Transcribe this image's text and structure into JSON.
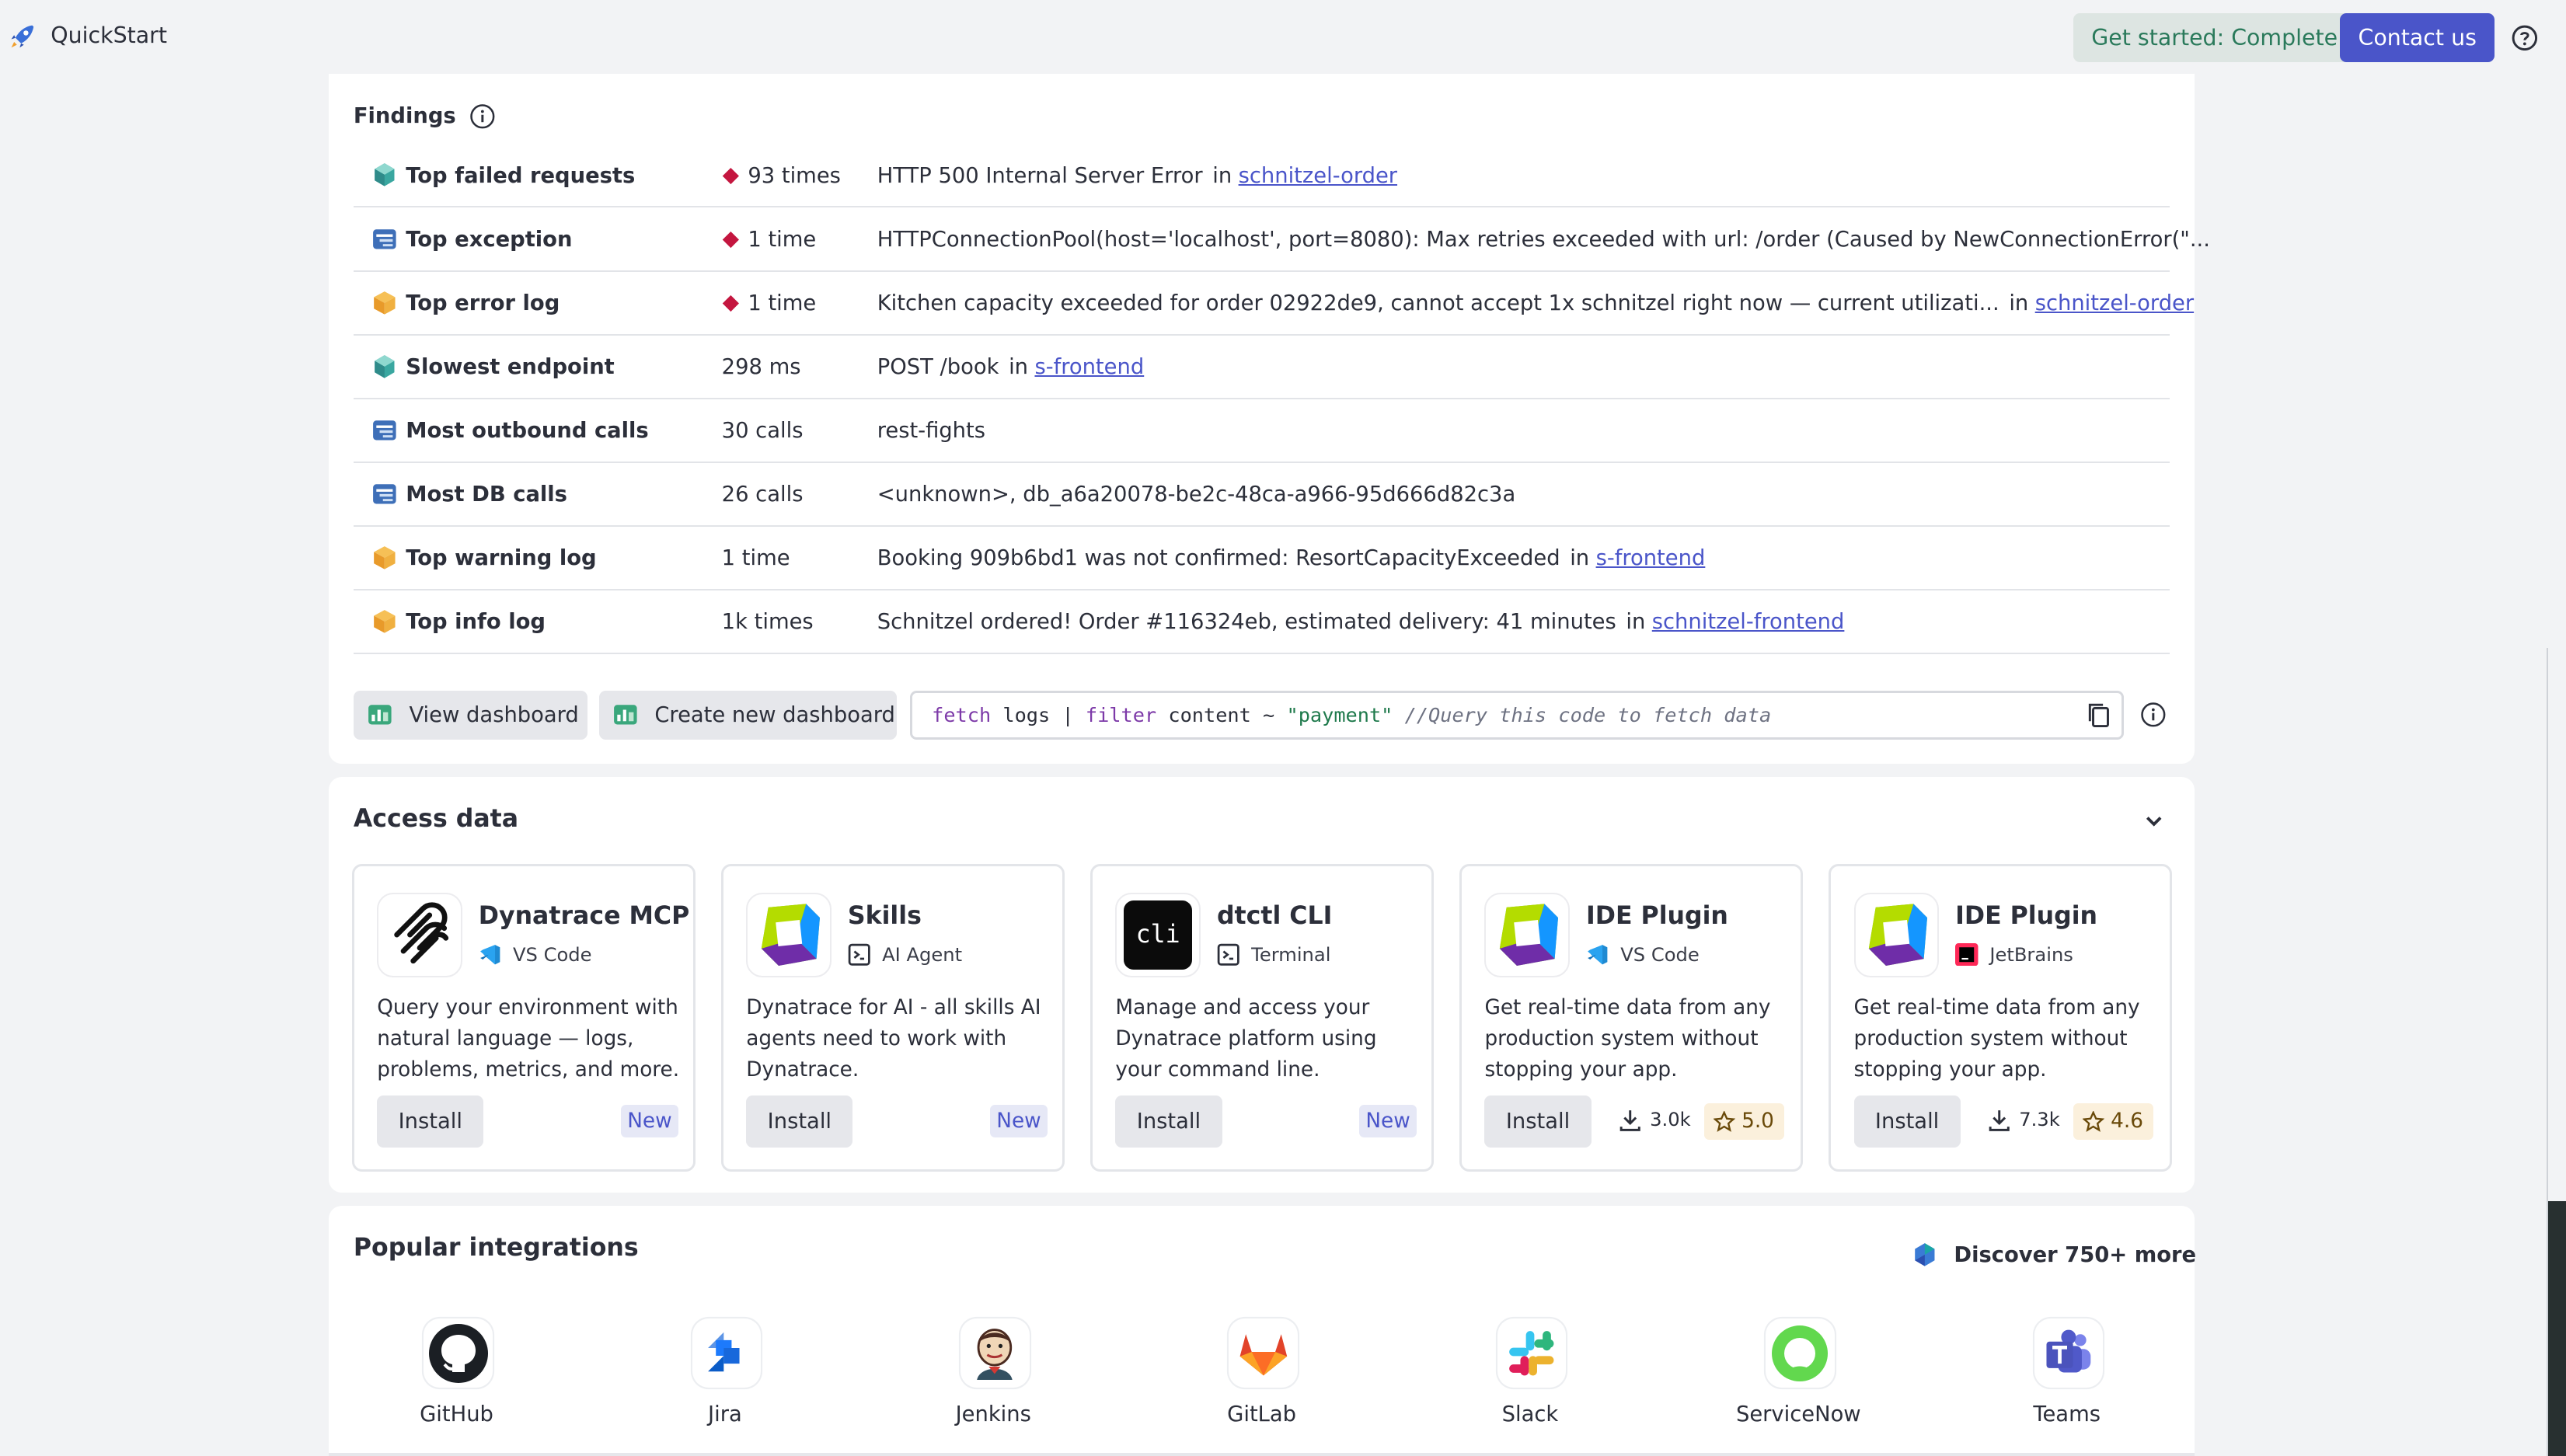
{
  "header": {
    "app_title": "QuickStart",
    "get_started_label": "Get started: Complete",
    "contact_label": "Contact us"
  },
  "findings": {
    "title": "Findings",
    "rows": [
      {
        "label": "Top failed requests",
        "metric": "93 times",
        "critical": true,
        "detail": "HTTP 500 Internal Server Error",
        "in": "in",
        "link": "schnitzel-order",
        "icon": "service-icon"
      },
      {
        "label": "Top exception",
        "metric": "1 time",
        "critical": true,
        "detail": "HTTPConnectionPool(host='localhost', port=8080): Max retries exceeded with url: /order (Caused by NewConnectionError(\"...",
        "in": "",
        "link": "",
        "icon": "trace-icon"
      },
      {
        "label": "Top error log",
        "metric": "1 time",
        "critical": true,
        "detail": "Kitchen capacity exceeded for order 02922de9, cannot accept 1x schnitzel right now — current utilizati...",
        "in": "in",
        "link": "schnitzel-order",
        "icon": "log-icon"
      },
      {
        "label": "Slowest endpoint",
        "metric": "298 ms",
        "critical": false,
        "detail": "POST /book",
        "in": "in",
        "link": "s-frontend",
        "icon": "service-icon"
      },
      {
        "label": "Most outbound calls",
        "metric": "30 calls",
        "critical": false,
        "detail": "rest-fights",
        "in": "",
        "link": "",
        "icon": "trace-icon"
      },
      {
        "label": "Most DB calls",
        "metric": "26 calls",
        "critical": false,
        "detail": "<unknown>, db_a6a20078-be2c-48ca-a966-95d666d82c3a",
        "in": "",
        "link": "",
        "icon": "trace-icon"
      },
      {
        "label": "Top warning log",
        "metric": "1 time",
        "critical": false,
        "detail": "Booking 909b6bd1 was not confirmed: ResortCapacityExceeded",
        "in": "in",
        "link": "s-frontend",
        "icon": "log-icon"
      },
      {
        "label": "Top info log",
        "metric": "1k times",
        "critical": false,
        "detail": "Schnitzel ordered! Order #116324eb, estimated delivery: 41 minutes",
        "in": "in",
        "link": "schnitzel-frontend",
        "icon": "log-icon"
      }
    ],
    "view_dashboard_label": "View dashboard",
    "create_dashboard_label": "Create new dashboard",
    "query": {
      "kw1": "fetch",
      "t1": " logs | ",
      "kw2": "filter",
      "t2": " content ~ ",
      "str": "\"payment\"",
      "t3": " ",
      "comment": "//Query this code to fetch data"
    }
  },
  "access_data": {
    "title": "Access data",
    "tiles": [
      {
        "name": "Dynatrace MCP",
        "platform": "VS Code",
        "desc": "Query your environment with natural language — logs, problems, metrics, and more.",
        "install": "Install",
        "badge": "New"
      },
      {
        "name": "Skills",
        "platform": "AI Agent",
        "desc": "Dynatrace for AI - all skills AI agents need to work with Dynatrace.",
        "install": "Install",
        "badge": "New"
      },
      {
        "name": "dtctl CLI",
        "platform": "Terminal",
        "desc": "Manage and access your Dynatrace platform using your command line.",
        "install": "Install",
        "badge": "New",
        "icon_text": "cli"
      },
      {
        "name": "IDE Plugin",
        "platform": "VS Code",
        "desc": "Get real-time data from any production system without stopping your app.",
        "install": "Install",
        "downloads": "3.0k",
        "rating": "5.0"
      },
      {
        "name": "IDE Plugin",
        "platform": "JetBrains",
        "desc": "Get real-time data from any production system without stopping your app.",
        "install": "Install",
        "downloads": "7.3k",
        "rating": "4.6"
      }
    ]
  },
  "integrations": {
    "title": "Popular integrations",
    "discover_label": "Discover 750+ more",
    "items": [
      "GitHub",
      "Jira",
      "Jenkins",
      "GitLab",
      "Slack",
      "ServiceNow",
      "Teams"
    ]
  },
  "colors": {
    "accent": "#4a55c9",
    "critical": "#c4163f",
    "complete_bg": "#dde5e2",
    "complete_text": "#2a7a5b"
  }
}
